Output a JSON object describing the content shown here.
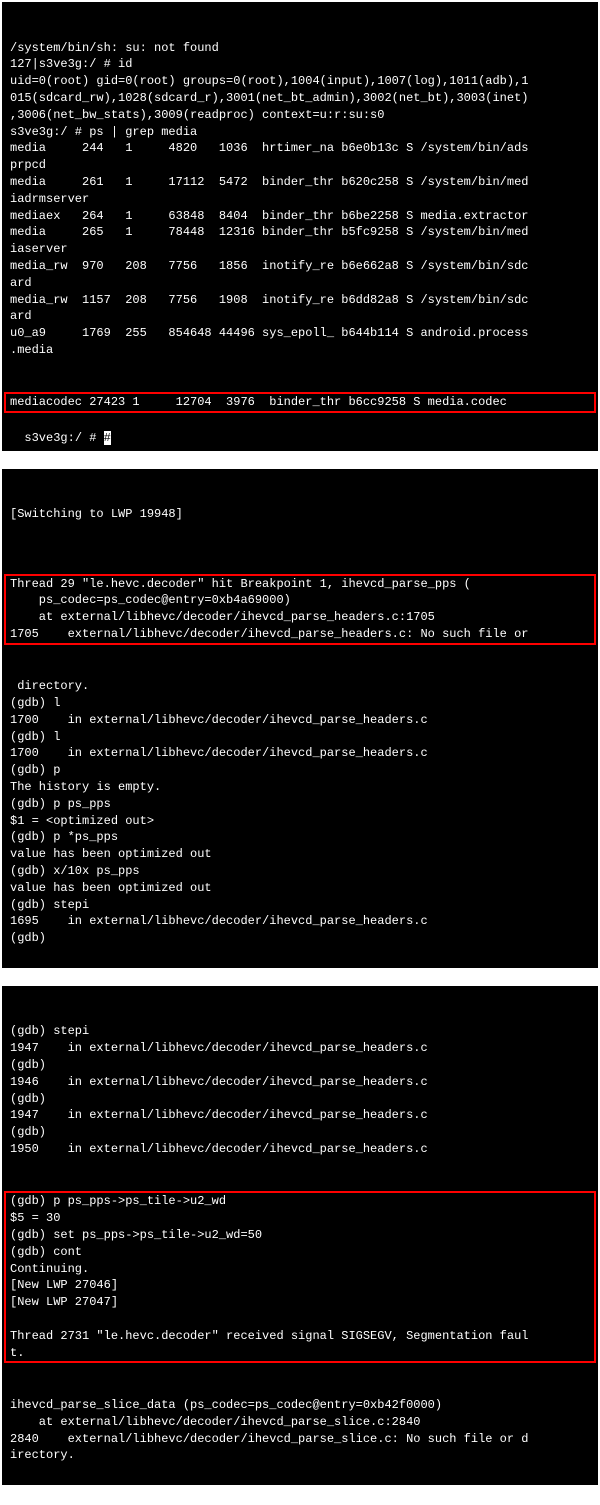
{
  "terminal1": {
    "lines": [
      "/system/bin/sh: su: not found",
      "127|s3ve3g:/ # id",
      "uid=0(root) gid=0(root) groups=0(root),1004(input),1007(log),1011(adb),1",
      "015(sdcard_rw),1028(sdcard_r),3001(net_bt_admin),3002(net_bt),3003(inet)",
      ",3006(net_bw_stats),3009(readproc) context=u:r:su:s0",
      "s3ve3g:/ # ps | grep media",
      "media     244   1     4820   1036  hrtimer_na b6e0b13c S /system/bin/ads",
      "prpcd",
      "media     261   1     17112  5472  binder_thr b620c258 S /system/bin/med",
      "iadrmserver",
      "mediaex   264   1     63848  8404  binder_thr b6be2258 S media.extractor",
      "media     265   1     78448  12316 binder_thr b5fc9258 S /system/bin/med",
      "iaserver",
      "media_rw  970   208   7756   1856  inotify_re b6e662a8 S /system/bin/sdc",
      "ard",
      "media_rw  1157  208   7756   1908  inotify_re b6dd82a8 S /system/bin/sdc",
      "ard",
      "u0_a9     1769  255   854648 44496 sys_epoll_ b644b114 S android.process",
      ".media"
    ],
    "highlighted": "mediacodec 27423 1     12704  3976  binder_thr b6cc9258 S media.codec   ",
    "after": "s3ve3g:/ # ",
    "cursor": "#"
  },
  "terminal2": {
    "before": [
      "[Switching to LWP 19948]",
      ""
    ],
    "highlighted": [
      "Thread 29 \"le.hevc.decoder\" hit Breakpoint 1, ihevcd_parse_pps (",
      "    ps_codec=ps_codec@entry=0xb4a69000)",
      "    at external/libhevc/decoder/ihevcd_parse_headers.c:1705",
      "1705    external/libhevc/decoder/ihevcd_parse_headers.c: No such file or"
    ],
    "after": [
      " directory.",
      "(gdb) l",
      "1700    in external/libhevc/decoder/ihevcd_parse_headers.c",
      "(gdb) l",
      "1700    in external/libhevc/decoder/ihevcd_parse_headers.c",
      "(gdb) p",
      "The history is empty.",
      "(gdb) p ps_pps",
      "$1 = <optimized out>",
      "(gdb) p *ps_pps",
      "value has been optimized out",
      "(gdb) x/10x ps_pps",
      "value has been optimized out",
      "(gdb) stepi",
      "1695    in external/libhevc/decoder/ihevcd_parse_headers.c",
      "(gdb)"
    ]
  },
  "terminal3": {
    "before": [
      "(gdb) stepi",
      "1947    in external/libhevc/decoder/ihevcd_parse_headers.c",
      "(gdb)",
      "1946    in external/libhevc/decoder/ihevcd_parse_headers.c",
      "(gdb)",
      "1947    in external/libhevc/decoder/ihevcd_parse_headers.c",
      "(gdb)",
      "1950    in external/libhevc/decoder/ihevcd_parse_headers.c"
    ],
    "highlighted": [
      "(gdb) p ps_pps->ps_tile->u2_wd",
      "$5 = 30",
      "(gdb) set ps_pps->ps_tile->u2_wd=50",
      "(gdb) cont",
      "Continuing.",
      "[New LWP 27046]",
      "[New LWP 27047]",
      "",
      "Thread 2731 \"le.hevc.decoder\" received signal SIGSEGV, Segmentation faul",
      "t."
    ],
    "after": [
      "ihevcd_parse_slice_data (ps_codec=ps_codec@entry=0xb42f0000)",
      "    at external/libhevc/decoder/ihevcd_parse_slice.c:2840",
      "2840    external/libhevc/decoder/ihevcd_parse_slice.c: No such file or d",
      "irectory."
    ]
  }
}
